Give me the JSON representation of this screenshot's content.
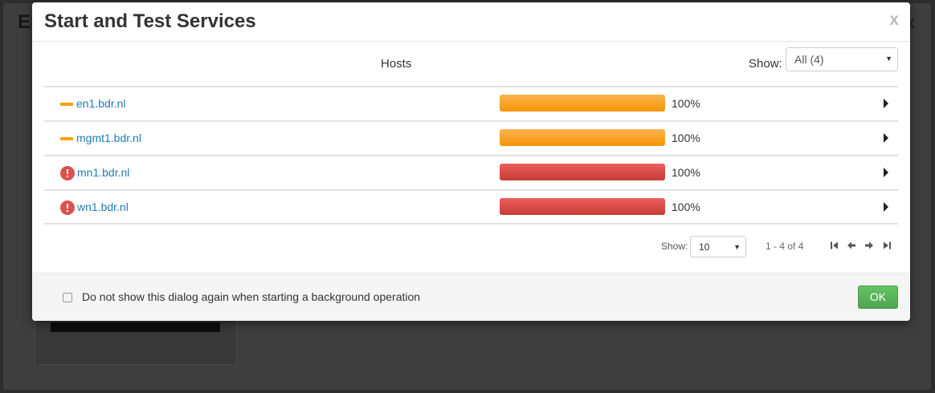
{
  "background": {
    "title": "Er",
    "close": "x"
  },
  "modal": {
    "title": "Start and Test Services",
    "close": "x"
  },
  "table": {
    "column_header": "Hosts",
    "filter_label": "Show:",
    "filter_value": "All (4)",
    "rows": [
      {
        "host": "en1.bdr.nl",
        "status": "warning",
        "progress_label": "100%",
        "progress": 100
      },
      {
        "host": "mgmt1.bdr.nl",
        "status": "warning",
        "progress_label": "100%",
        "progress": 100
      },
      {
        "host": "mn1.bdr.nl",
        "status": "alert",
        "progress_label": "100%",
        "progress": 100
      },
      {
        "host": "wn1.bdr.nl",
        "status": "alert",
        "progress_label": "100%",
        "progress": 100
      }
    ]
  },
  "pagination": {
    "show_label": "Show:",
    "page_size": "10",
    "range": "1 - 4 of 4",
    "icons": [
      "first-page-icon",
      "prev-page-icon",
      "next-page-icon",
      "last-page-icon"
    ]
  },
  "footer": {
    "checkbox_label": "Do not show this dialog again when starting a background operation",
    "ok_label": "OK"
  },
  "colors": {
    "warning": "#f89406",
    "danger": "#d9534f",
    "link": "#1f7bb8",
    "ok": "#5bb75b"
  }
}
